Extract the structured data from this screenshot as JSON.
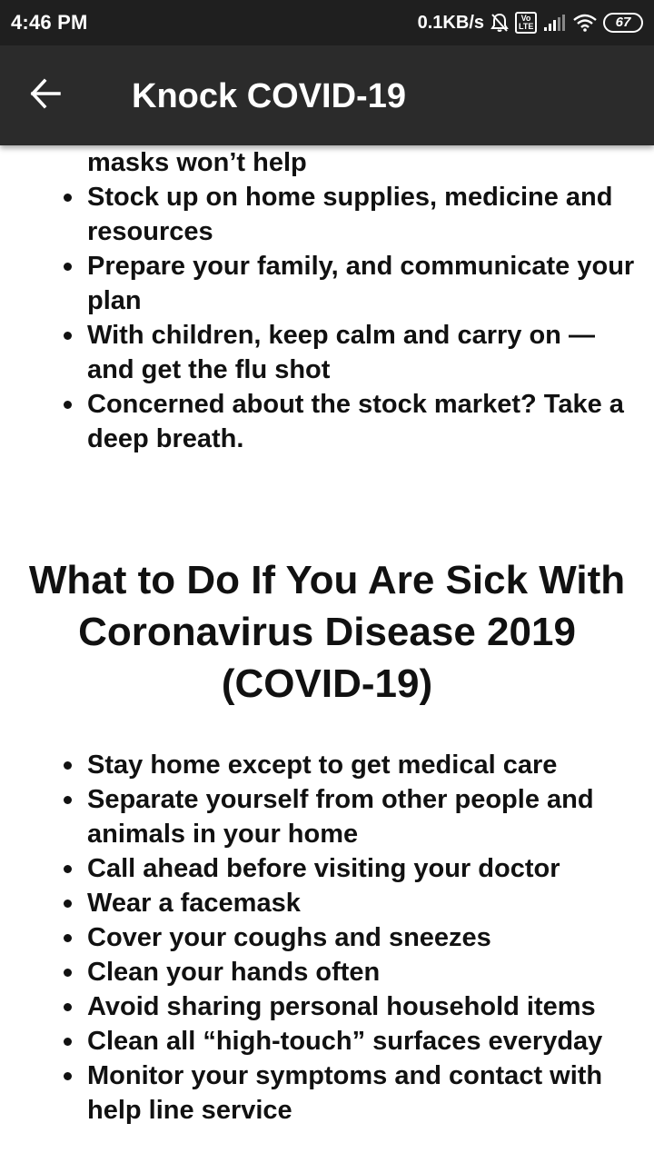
{
  "status_bar": {
    "time": "4:46 PM",
    "network_speed": "0.1KB/s",
    "volte_label": "Vo LTE",
    "battery_level": "67",
    "icons": [
      "mute-bell-icon",
      "volte-icon",
      "signal-icon",
      "wifi-icon",
      "battery-icon"
    ]
  },
  "app_bar": {
    "title": "Knock COVID-19",
    "back_icon": "arrow-left-icon"
  },
  "content": {
    "top_list": [
      "Wash your hands and stay home if sick; masks won’t help",
      "Stock up on home supplies, medicine and resources",
      "Prepare your family, and communicate your plan",
      "With children, keep calm and carry on — and get the flu shot",
      "Concerned about the stock market? Take a deep breath."
    ],
    "section_heading": "What to Do If You Are Sick With Coronavirus Disease 2019 (COVID-19)",
    "sick_list": [
      "Stay home except to get medical care",
      "Separate yourself from other people and animals in your home",
      "Call ahead before visiting your doctor",
      "Wear a facemask",
      "Cover your coughs and sneezes",
      "Clean your hands often",
      "Avoid sharing personal household items",
      "Clean all “high-touch” surfaces everyday",
      "Monitor your symptoms and contact with help line service"
    ]
  }
}
